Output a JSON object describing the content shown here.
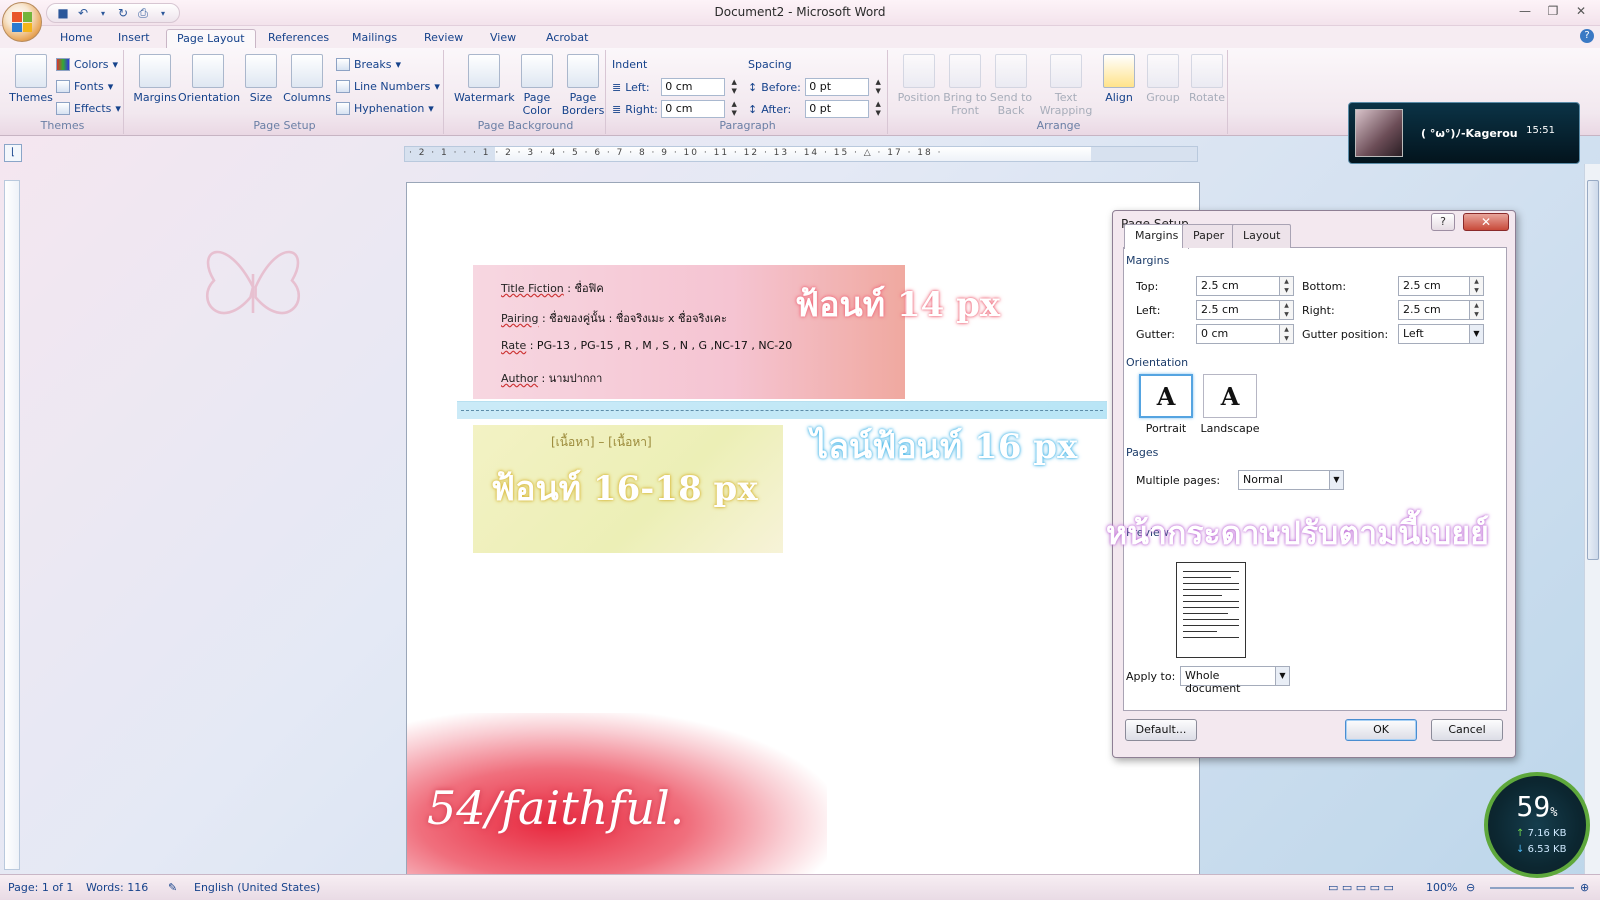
{
  "window": {
    "title": "Document2 - Microsoft Word"
  },
  "tabs": [
    "Home",
    "Insert",
    "Page Layout",
    "References",
    "Mailings",
    "Review",
    "View",
    "Acrobat"
  ],
  "active_tab": "Page Layout",
  "ribbon": {
    "themes": {
      "themes": "Themes",
      "colors": "Colors",
      "fonts": "Fonts",
      "effects": "Effects",
      "label": "Themes"
    },
    "page_setup": {
      "margins": "Margins",
      "orientation": "Orientation",
      "size": "Size",
      "columns": "Columns",
      "breaks": "Breaks",
      "line_numbers": "Line Numbers",
      "hyphenation": "Hyphenation",
      "label": "Page Setup"
    },
    "page_background": {
      "watermark": "Watermark",
      "page_color_1": "Page",
      "page_color_2": "Color",
      "page_borders_1": "Page",
      "page_borders_2": "Borders",
      "label": "Page Background"
    },
    "paragraph": {
      "indent": "Indent",
      "left_label": "Left:",
      "left_value": "0 cm",
      "right_label": "Right:",
      "right_value": "0 cm",
      "spacing": "Spacing",
      "before_label": "Before:",
      "before_value": "0 pt",
      "after_label": "After:",
      "after_value": "0 pt",
      "label": "Paragraph"
    },
    "arrange": {
      "position": "Position",
      "bring_1": "Bring to",
      "bring_2": "Front",
      "send_1": "Send to",
      "send_2": "Back",
      "wrap_1": "Text",
      "wrap_2": "Wrapping",
      "align": "Align",
      "group": "Group",
      "rotate": "Rotate",
      "label": "Arrange"
    }
  },
  "widget": {
    "name": "( °ω°)ﾉ-Kagerou",
    "time": "15:51"
  },
  "ruler": {
    "ticks": "· 2 · 1 · · · 1 · 2 · 3 · 4 · 5 · 6 · 7 · 8 · 9 · 10 · 11 · 12 · 13 · 14 · 15 · △ · 17 · 18 ·"
  },
  "document": {
    "title_key": "Title Fiction",
    "title_val": " : ชื่อฟิค",
    "pairing_key": "Pairing",
    "pairing_val": " : ชื่อของคู่นั้น : ชื่อจริงเมะ x ชื่อจริงเคะ",
    "rate_key": "Rate",
    "rate_val": " : PG-13 , PG-15 , R , M , S , N , G ,NC-17 , NC-20",
    "author_key": "Author",
    "author_val": " : นามปากกา",
    "content_placeholder": "[เนื้อหา] – [เนื้อหา]",
    "annotation_14": "ฟ้อนท์ 14 px",
    "annotation_line": "ไลน์ฟ้อนท์ 16 px",
    "annotation_16_18": "ฟ้อนท์ 16-18 px",
    "annotation_paper": "หน้ากระดาษปรับตามนี้เบยย์",
    "signature": "54/faithful."
  },
  "dialog": {
    "title": "Page Setup",
    "help": "?",
    "tabs": [
      "Margins",
      "Paper",
      "Layout"
    ],
    "margins_section": "Margins",
    "top_label": "Top:",
    "top_value": "2.5 cm",
    "bottom_label": "Bottom:",
    "bottom_value": "2.5 cm",
    "left_label": "Left:",
    "left_value": "2.5 cm",
    "right_label": "Right:",
    "right_value": "2.5 cm",
    "gutter_label": "Gutter:",
    "gutter_value": "0 cm",
    "gutter_pos_label": "Gutter position:",
    "gutter_pos_value": "Left",
    "orientation_section": "Orientation",
    "portrait": "Portrait",
    "landscape": "Landscape",
    "pages_section": "Pages",
    "multiple_pages_label": "Multiple pages:",
    "multiple_pages_value": "Normal",
    "preview_section": "Preview",
    "apply_label": "Apply to:",
    "apply_value": "Whole document",
    "default_btn": "Default...",
    "ok_btn": "OK",
    "cancel_btn": "Cancel"
  },
  "gauge": {
    "percent": "59",
    "unit": "%",
    "up": "7.16 KB",
    "down": "6.53 KB"
  },
  "status": {
    "page": "Page: 1 of 1",
    "words": "Words: 116",
    "language": "English (United States)",
    "zoom": "100%"
  }
}
